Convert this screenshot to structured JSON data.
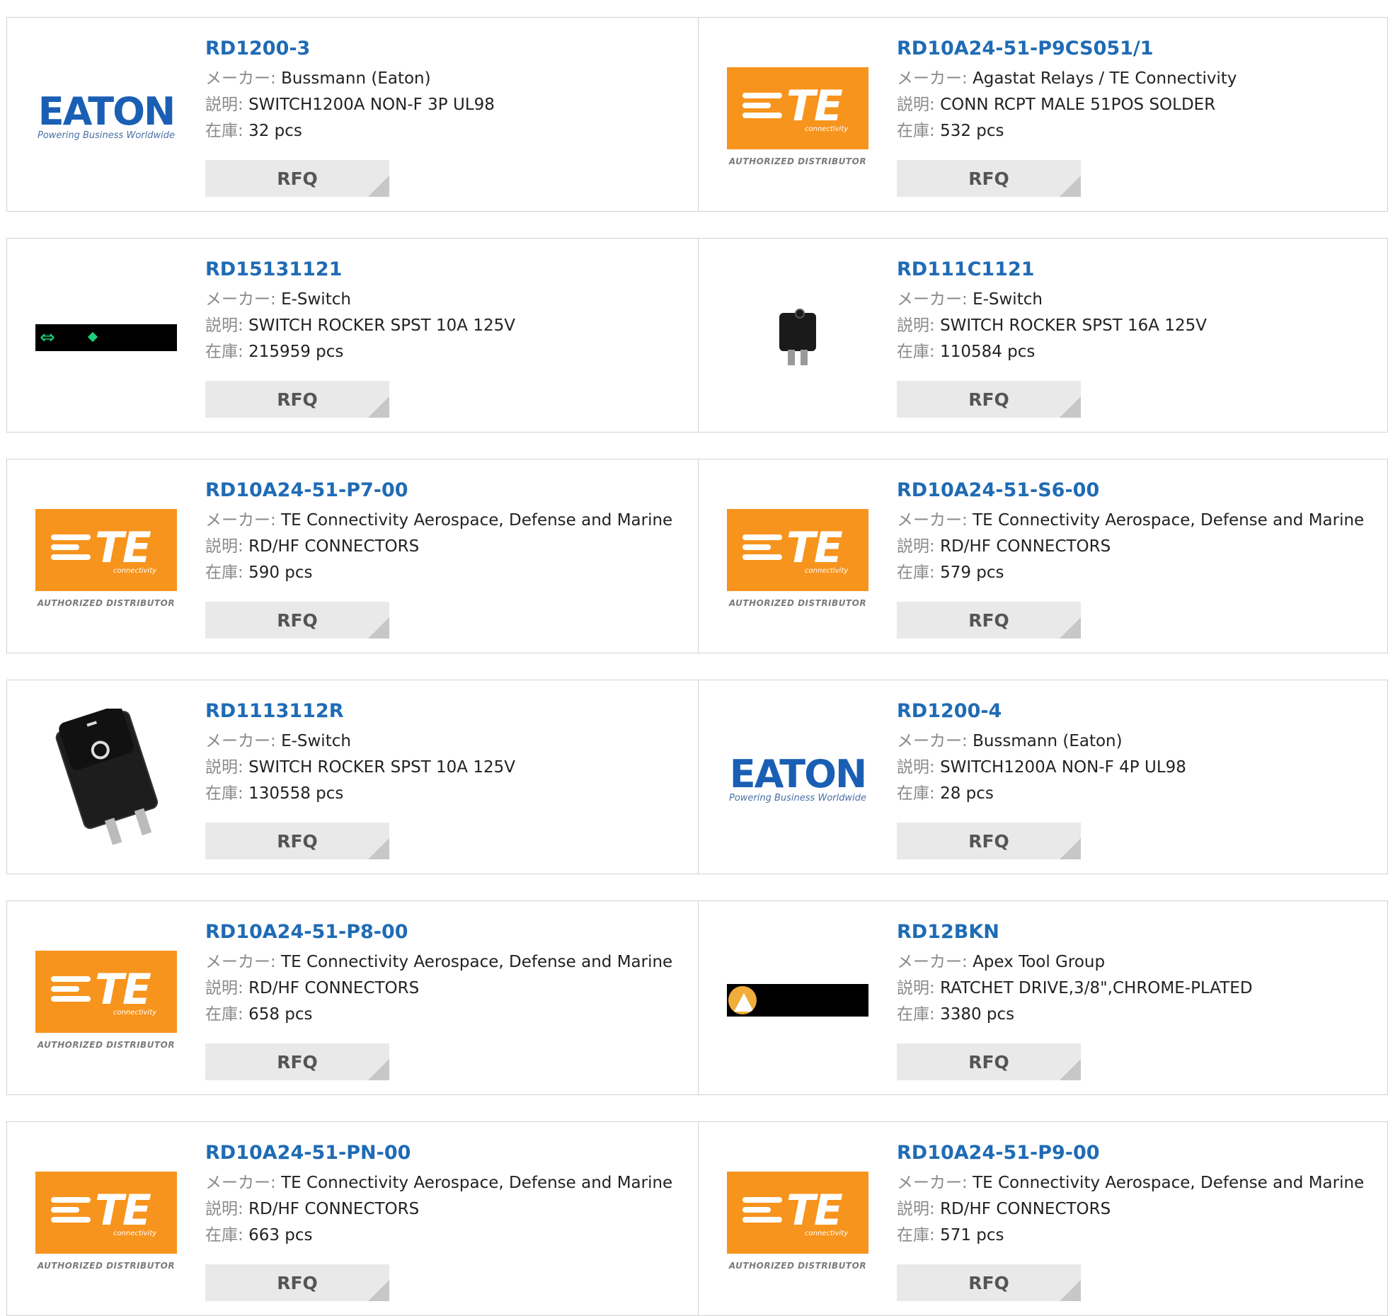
{
  "labels": {
    "maker": "メーカー:",
    "desc": "説明:",
    "stock": "在庫:",
    "rfq": "RFQ"
  },
  "logo_text": {
    "eaton_word": "EATON",
    "eaton_tag": "Powering Business Worldwide",
    "te_word": "TE",
    "te_sub": "connectivity",
    "te_caption": "AUTHORIZED DISTRIBUTOR"
  },
  "products": [
    {
      "pn": "RD1200-3",
      "maker": "Bussmann (Eaton)",
      "desc": "SWITCH1200A NON-F 3P UL98",
      "stock": "32 pcs",
      "logo": "eaton-logo"
    },
    {
      "pn": "RD10A24-51-P9CS051/1",
      "maker": "Agastat Relays / TE Connectivity",
      "desc": "CONN RCPT MALE 51POS SOLDER",
      "stock": "532 pcs",
      "logo": "te-logo"
    },
    {
      "pn": "RD15131121",
      "maker": "E-Switch",
      "desc": "SWITCH ROCKER SPST 10A 125V",
      "stock": "215959 pcs",
      "logo": "eswitch-strip"
    },
    {
      "pn": "RD111C1121",
      "maker": "E-Switch",
      "desc": "SWITCH ROCKER SPST 16A 125V",
      "stock": "110584 pcs",
      "logo": "rocker-small"
    },
    {
      "pn": "RD10A24-51-P7-00",
      "maker": "TE Connectivity Aerospace, Defense and Marine",
      "desc": "RD/HF CONNECTORS",
      "stock": "590 pcs",
      "logo": "te-logo"
    },
    {
      "pn": "RD10A24-51-S6-00",
      "maker": "TE Connectivity Aerospace, Defense and Marine",
      "desc": "RD/HF CONNECTORS",
      "stock": "579 pcs",
      "logo": "te-logo"
    },
    {
      "pn": "RD1113112R",
      "maker": "E-Switch",
      "desc": "SWITCH ROCKER SPST 10A 125V",
      "stock": "130558 pcs",
      "logo": "rocker-large"
    },
    {
      "pn": "RD1200-4",
      "maker": "Bussmann (Eaton)",
      "desc": "SWITCH1200A NON-F 4P UL98",
      "stock": "28 pcs",
      "logo": "eaton-logo"
    },
    {
      "pn": "RD10A24-51-P8-00",
      "maker": "TE Connectivity Aerospace, Defense and Marine",
      "desc": "RD/HF CONNECTORS",
      "stock": "658 pcs",
      "logo": "te-logo"
    },
    {
      "pn": "RD12BKN",
      "maker": "Apex Tool Group",
      "desc": "RATCHET DRIVE,3/8\",CHROME-PLATED",
      "stock": "3380 pcs",
      "logo": "apex-logo"
    },
    {
      "pn": "RD10A24-51-PN-00",
      "maker": "TE Connectivity Aerospace, Defense and Marine",
      "desc": "RD/HF CONNECTORS",
      "stock": "663 pcs",
      "logo": "te-logo"
    },
    {
      "pn": "RD10A24-51-P9-00",
      "maker": "TE Connectivity Aerospace, Defense and Marine",
      "desc": "RD/HF CONNECTORS",
      "stock": "571 pcs",
      "logo": "te-logo"
    }
  ],
  "colors": {
    "link": "#1f6bb5",
    "te_orange": "#f7941d",
    "eaton_blue": "#1a5fb4",
    "rfq_bg": "#e9e9e9",
    "border": "#d2d2d2"
  }
}
